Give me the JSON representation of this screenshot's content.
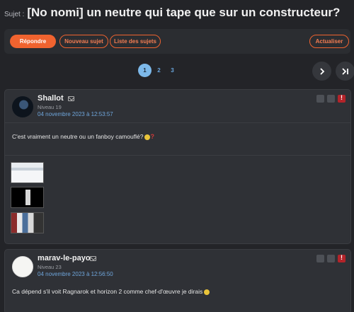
{
  "subject": {
    "label": "Sujet :",
    "title": "[No nomi] un neutre qui tape que sur un constructeur?"
  },
  "actions": {
    "reply": "Répondre",
    "new_topic": "Nouveau sujet",
    "topic_list": "Liste des sujets",
    "refresh": "Actualiser"
  },
  "pagination": {
    "pages": [
      "1",
      "2",
      "3"
    ],
    "current": "1"
  },
  "posts": [
    {
      "author": "Shallot",
      "level": "Niveau 19",
      "date": "04 novembre 2023 à 12:53:57",
      "text": "C'est vraiment un neutre ou un fanboy camouflé?",
      "icons": [
        "mail-icon",
        "emoji-thinking-icon",
        "question-icon"
      ]
    },
    {
      "author": "marav-le-payo",
      "level": "Niveau 23",
      "date": "04 novembre 2023 à 12:56:50",
      "text": "Ca dépend s'il voit Ragnarok et horizon 2 comme chef-d'œuvre je dirais",
      "icons": [
        "mail-icon",
        "emoji-thinking-icon"
      ]
    }
  ],
  "colors": {
    "accent": "#f0632f",
    "link": "#6fa6dc",
    "page_active": "#7db9ea",
    "background": "#232428",
    "card": "#2f3136",
    "warn": "#b3242a"
  }
}
